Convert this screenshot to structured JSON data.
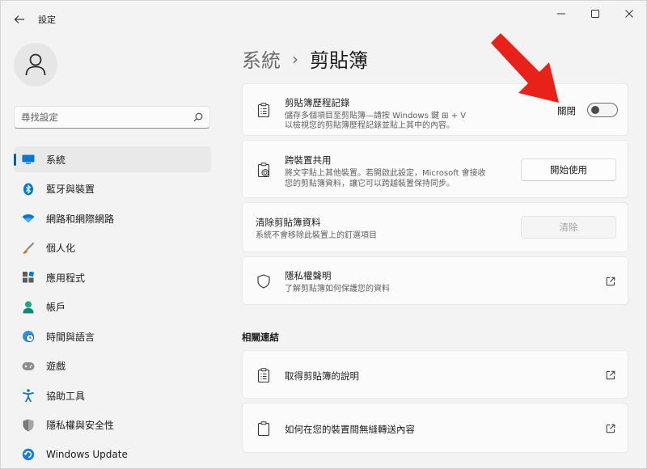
{
  "window": {
    "app_title": "設定",
    "back_icon": "arrow-left-icon",
    "controls": [
      "minimize-icon",
      "maximize-icon",
      "close-icon"
    ]
  },
  "sidebar": {
    "search_placeholder": "尋找設定",
    "nav": [
      {
        "label": "系統",
        "icon": "monitor-icon",
        "active": true
      },
      {
        "label": "藍牙與裝置",
        "icon": "bluetooth-icon"
      },
      {
        "label": "網路和網際網路",
        "icon": "wifi-icon"
      },
      {
        "label": "個人化",
        "icon": "brush-icon"
      },
      {
        "label": "應用程式",
        "icon": "apps-icon"
      },
      {
        "label": "帳戶",
        "icon": "person-icon"
      },
      {
        "label": "時間與語言",
        "icon": "globe-clock-icon"
      },
      {
        "label": "遊戲",
        "icon": "gamepad-icon"
      },
      {
        "label": "協助工具",
        "icon": "accessibility-icon"
      },
      {
        "label": "隱私權與安全性",
        "icon": "shield-icon"
      },
      {
        "label": "Windows Update",
        "icon": "update-icon"
      }
    ]
  },
  "main": {
    "breadcrumb": {
      "parent": "系統",
      "separator": "›",
      "current": "剪貼簿"
    },
    "cards": {
      "history": {
        "title": "剪貼簿歷程記錄",
        "desc_1": "儲存多個項目至剪貼簿—請按 Windows 鍵 ⊞ + V",
        "desc_2": "以檢視您的剪貼簿歷程記錄並貼上其中的內容。",
        "toggle_label": "關閉",
        "toggle_on": false
      },
      "sync": {
        "title": "跨裝置共用",
        "desc_1": "將文字貼上其他裝置。若開啟此設定，Microsoft 會接收",
        "desc_2": "您的剪貼簿資料，讓它可以跨越裝置保持同步。",
        "button": "開始使用"
      },
      "clear": {
        "title": "清除剪貼簿資料",
        "desc": "系統不會移除此裝置上的釘選項目",
        "button": "清除"
      },
      "privacy": {
        "title": "隱私權聲明",
        "desc": "了解剪貼簿如何保護您的資料"
      }
    },
    "related": {
      "title": "相關連結",
      "links": [
        {
          "label": "取得剪貼簿的說明",
          "icon": "clipboard-list-icon"
        },
        {
          "label": "如何在您的裝置間無縫轉送內容",
          "icon": "clipboard-icon"
        }
      ]
    }
  },
  "colors": {
    "accent": "#005fb8",
    "annotation_arrow": "#e8211b"
  }
}
